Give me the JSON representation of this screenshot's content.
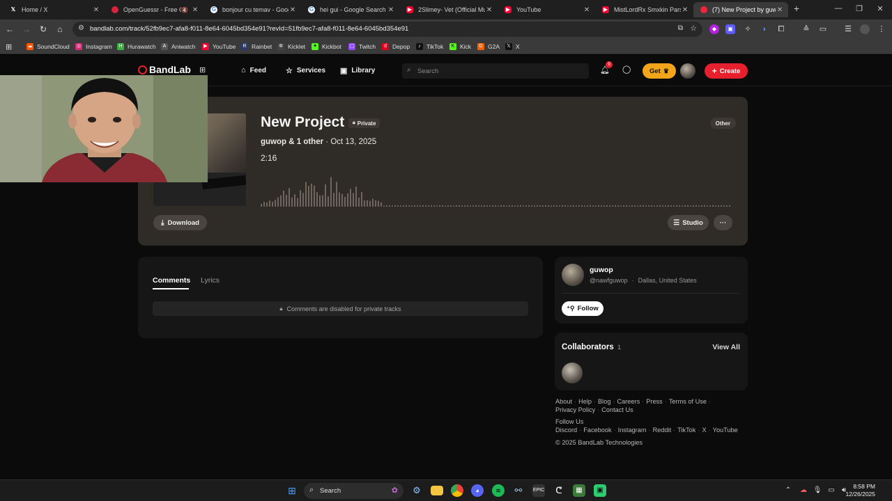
{
  "browser": {
    "tabs": [
      {
        "label": "Home / X",
        "icon": "x-icon",
        "color": "#000000"
      },
      {
        "label": "OpenGuessr - Free Ga",
        "icon": "openguessr-icon",
        "color": "#d4233b"
      },
      {
        "label": "bonjour cu temav - Google",
        "icon": "google-icon",
        "color": "#4285f4"
      },
      {
        "label": "hei gui - Google Search",
        "icon": "google-icon",
        "color": "#4285f4"
      },
      {
        "label": "2Slimey- Vet (Official Mus",
        "icon": "youtube-icon",
        "color": "#ff0033"
      },
      {
        "label": "YouTube",
        "icon": "youtube-icon",
        "color": "#ff0033"
      },
      {
        "label": "MistLordRx Smxkin Parsa",
        "icon": "youtube-icon",
        "color": "#ff0033"
      },
      {
        "label": "(7) New Project by guwop",
        "icon": "bandlab-icon",
        "color": "#f0243c"
      }
    ],
    "url": "bandlab.com/track/52fb9ec7-afa8-f011-8e64-6045bd354e91?revId=51fb9ec7-afa8-f011-8e64-6045bd354e91",
    "bookmarks": [
      {
        "label": "SoundCloud",
        "color": "#ff5500"
      },
      {
        "label": "Instagram",
        "color": "#d62976"
      },
      {
        "label": "Hurawatch",
        "color": "#3cb043"
      },
      {
        "label": "Aniwatch",
        "color": "#555555"
      },
      {
        "label": "YouTube",
        "color": "#ff0033"
      },
      {
        "label": "Rainbet",
        "color": "#2b3a67"
      },
      {
        "label": "Kicklet",
        "color": "#444444"
      },
      {
        "label": "Kickbot",
        "color": "#53fc18"
      },
      {
        "label": "Twitch",
        "color": "#9146ff"
      },
      {
        "label": "Depop",
        "color": "#e2001a"
      },
      {
        "label": "TikTok",
        "color": "#111111"
      },
      {
        "label": "Kick",
        "color": "#53fc18"
      },
      {
        "label": "G2A",
        "color": "#f05f00"
      },
      {
        "label": "X",
        "color": "#111111"
      }
    ]
  },
  "site": {
    "logo": "BandLab",
    "nav": {
      "feed": "Feed",
      "services": "Services",
      "library": "Library"
    },
    "search_placeholder": "Search",
    "notification_count": "9",
    "get_label": "Get",
    "create_label": "Create",
    "accent": "#e8202e",
    "gold": "#f2a51a"
  },
  "track": {
    "title": "New Project",
    "visibility": "Private",
    "genre": "Other",
    "artists": "guwop & 1 other",
    "date": "· Oct 13, 2025",
    "duration": "2:16",
    "download_label": "Download",
    "studio_label": "Studio",
    "more_label": "···"
  },
  "comments": {
    "tab_comments": "Comments",
    "tab_lyrics": "Lyrics",
    "disabled_message": "Comments are disabled for private tracks"
  },
  "artist": {
    "name": "guwop",
    "handle": "@nawfguwop",
    "location": "Dallas, United States",
    "follow_label": "Follow"
  },
  "collaborators": {
    "title": "Collaborators",
    "count": "1",
    "view_all": "View All"
  },
  "footer": {
    "row1": [
      "About",
      "Help",
      "Blog",
      "Careers",
      "Press",
      "Terms of Use"
    ],
    "row2": [
      "Privacy Policy",
      "Contact Us"
    ],
    "follow_us": "Follow Us",
    "social": [
      "Discord",
      "Facebook",
      "Instagram",
      "Reddit",
      "TikTok",
      "X",
      "YouTube"
    ],
    "copyright": "© 2025 BandLab Technologies"
  },
  "taskbar": {
    "search_label": "Search",
    "time": "8:58 PM",
    "date": "12/26/2025"
  }
}
